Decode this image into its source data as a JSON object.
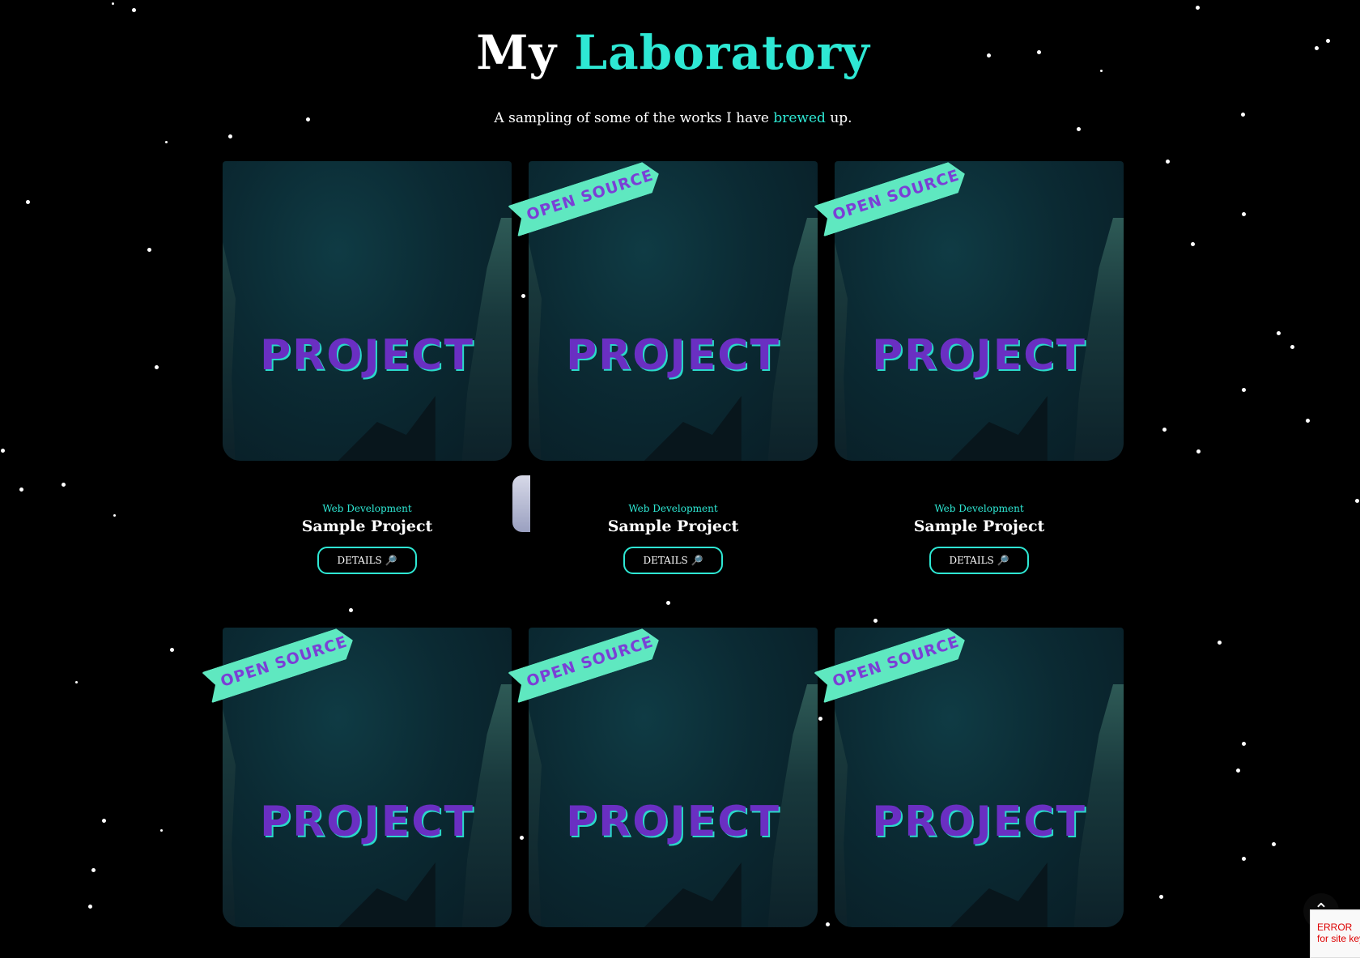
{
  "header": {
    "title_prefix": "My",
    "title_accent": "Laboratory",
    "subtitle_before": "A sampling of some of the works I have",
    "subtitle_accent": "brewed",
    "subtitle_after": "up."
  },
  "projects": [
    {
      "thumb_text": "PROJECT",
      "badge": "",
      "category": "Web Development",
      "name": "Sample Project",
      "button": "DETAILS 🔎"
    },
    {
      "thumb_text": "PROJECT",
      "badge": "OPEN SOURCE",
      "category": "Web Development",
      "name": "Sample Project",
      "button": "DETAILS 🔎"
    },
    {
      "thumb_text": "PROJECT",
      "badge": "OPEN SOURCE",
      "category": "Web Development",
      "name": "Sample Project",
      "button": "DETAILS 🔎"
    },
    {
      "thumb_text": "PROJECT",
      "badge": "OPEN SOURCE"
    },
    {
      "thumb_text": "PROJECT",
      "badge": "OPEN SOURCE"
    },
    {
      "thumb_text": "PROJECT",
      "badge": "OPEN SOURCE"
    }
  ],
  "scroll_top": {
    "icon": "chevron-up-icon",
    "glyph": "⌃"
  },
  "recaptcha": {
    "text": "ERROR for site key"
  },
  "colors": {
    "accent": "#2ee8d4",
    "background": "#000000",
    "title_text": "#ffffff",
    "thumb_text": "#6a2fc2",
    "badge": "#5fe8c0"
  }
}
